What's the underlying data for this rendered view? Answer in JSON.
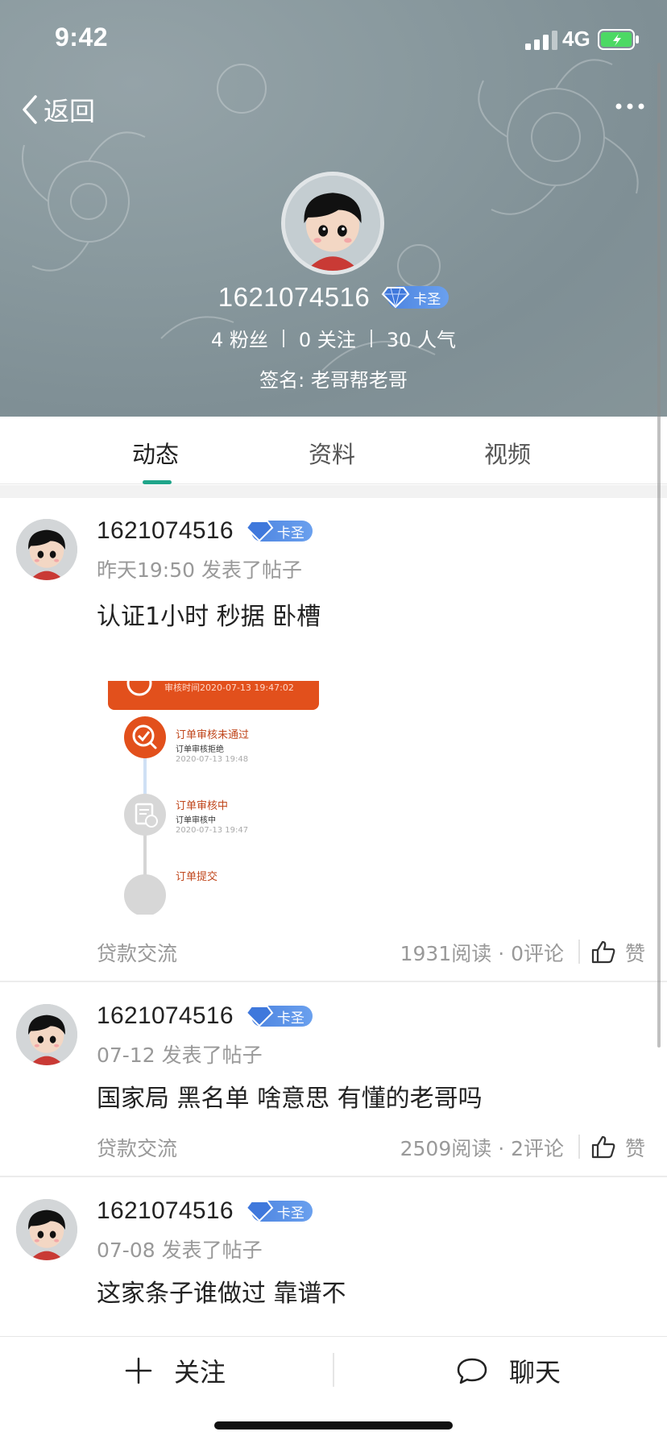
{
  "status_bar": {
    "time": "9:42",
    "network": "4G"
  },
  "nav": {
    "back_label": "返回",
    "more_icon": "more-dots-icon"
  },
  "profile": {
    "name": "1621074516",
    "badge": "卡圣",
    "followers": "4 粉丝",
    "following": "0 关注",
    "popularity": "30 人气",
    "signature": "签名: 老哥帮老哥"
  },
  "tabs": [
    {
      "label": "动态",
      "active": true
    },
    {
      "label": "资料",
      "active": false
    },
    {
      "label": "视频",
      "active": false
    }
  ],
  "posts": [
    {
      "author": "1621074516",
      "badge": "卡圣",
      "meta": "昨天19:50 发表了帖子",
      "text": "认证1小时 秒据 卧槽",
      "image": {
        "banner": "审核时间2020-07-13 19:47:02",
        "steps": [
          {
            "title": "订单审核未通过",
            "sub": "订单审核拒绝",
            "time": "2020-07-13 19:48"
          },
          {
            "title": "订单审核中",
            "sub": "订单审核中",
            "time": "2020-07-13 19:47"
          },
          {
            "title": "订单提交"
          }
        ]
      },
      "topic": "贷款交流",
      "stats": "1931阅读 · 0评论",
      "like_label": "赞"
    },
    {
      "author": "1621074516",
      "badge": "卡圣",
      "meta": "07-12 发表了帖子",
      "text": "国家局 黑名单 啥意思 有懂的老哥吗",
      "topic": "贷款交流",
      "stats": "2509阅读 · 2评论",
      "like_label": "赞"
    },
    {
      "author": "1621074516",
      "badge": "卡圣",
      "meta": "07-08 发表了帖子",
      "text": "这家条子谁做过 靠谱不"
    }
  ],
  "bottom_bar": {
    "follow_label": "关注",
    "chat_label": "聊天"
  },
  "colors": {
    "accent": "#1fa58a",
    "badge": "#4d84e0",
    "header_bg": "#8a9a9f",
    "timeline_orange": "#e2501c"
  }
}
